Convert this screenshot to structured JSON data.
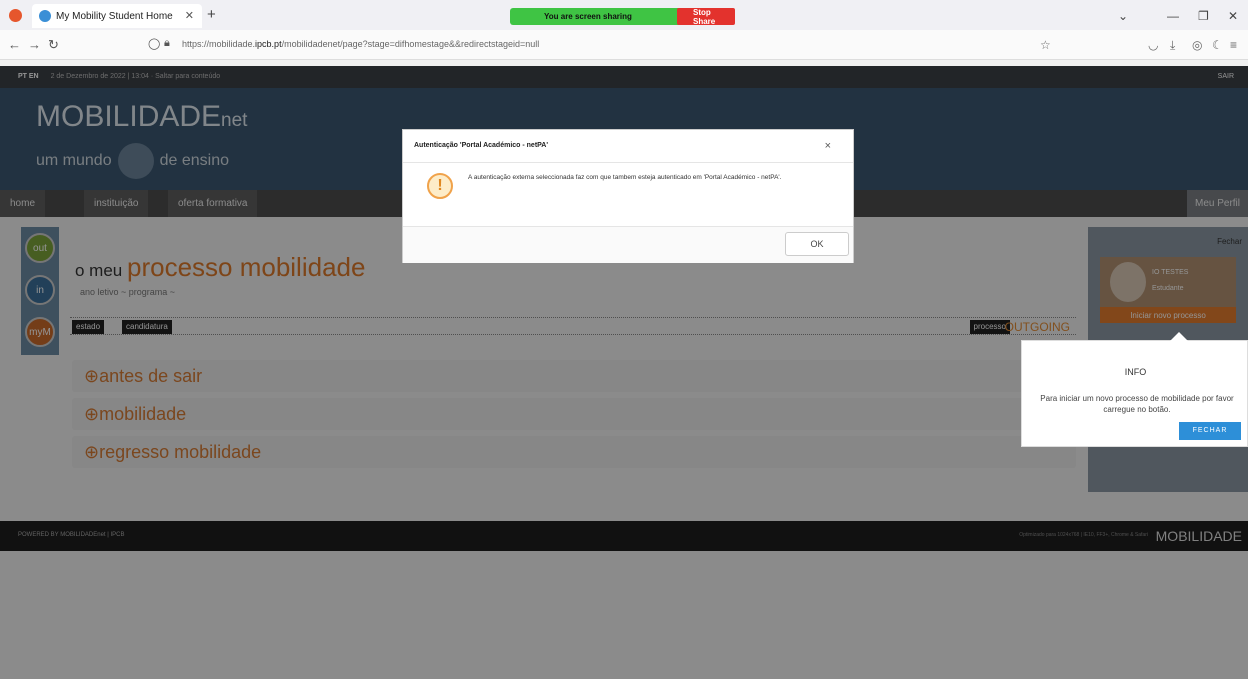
{
  "browser": {
    "tab_title": "My Mobility Student Home",
    "url_prefix": "https://mobilidade.",
    "url_host": "ipcb.pt",
    "url_path": "/mobilidadenet/page?stage=difhomestage&&redirectstageid=null",
    "share_text": "You are screen sharing",
    "stop_share": "Stop Share"
  },
  "site": {
    "lang": "PT EN",
    "date_line": "2 de Dezembro de 2022 | 13:04 · Saltar para conteúdo",
    "sair": "SAIR",
    "logo_main": "MOBILIDADE",
    "logo_suffix": "net",
    "tag_left": "um mundo",
    "tag_right": "de ensino",
    "nav": [
      "home",
      "instituição",
      "oferta formativa"
    ],
    "meu_perfil": "Meu Perfil",
    "side_out": "out",
    "side_in": "in",
    "side_my": "myM",
    "title_pre": "o meu ",
    "title_main": "processo mobilidade",
    "subtitle": "ano letivo ~ programa ~",
    "chip_estado": "estado",
    "chip_candidatura": "candidatura",
    "chip_processo": "processo",
    "outgoing": "OUTGOING",
    "sections": [
      "⊕antes de sair",
      "⊕mobilidade",
      "⊕regresso mobilidade"
    ],
    "fechar_link": "Fechar",
    "profile_name": "IO TESTES",
    "profile_role": "Estudante",
    "iniciar": "Iniciar novo processo",
    "footer_left": "POWERED BY MOBILIDADEnet | IPCB",
    "footer_right": "Optimizado para 1024x768 | IE10, FF3+, Chrome & Safari",
    "footer_brand": "MOBILIDADE"
  },
  "modal": {
    "title": "Autenticação 'Portal Académico - netPA'",
    "close": "×",
    "body": "A autenticação externa seleccionada faz com que tambem esteja autenticado em 'Portal Académico - netPA'.",
    "ok": "OK"
  },
  "info": {
    "title": "INFO",
    "message": "Para iniciar um novo processo de mobilidade por favor carregue no botão.",
    "button": "FECHAR"
  },
  "colors": {
    "accent": "#d9772a",
    "banner": "#3b5770",
    "info_button": "#2d8fd8"
  }
}
